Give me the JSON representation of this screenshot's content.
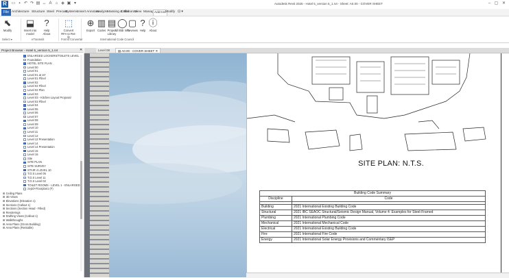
{
  "window": {
    "app_logo": "R",
    "title": "Autodesk Revit 2025 - Hotel 5_version 5_1.rvt - Sheet: A0.00 - COVER SHEET"
  },
  "menu": {
    "file": "File",
    "items": [
      "Architecture",
      "Structure",
      "Steel",
      "Precast",
      "Systems",
      "Insert",
      "Annotate",
      "Analyze",
      "Massing & Site",
      "Collaborate",
      "View",
      "Manage",
      "Add-Ins",
      "Modify"
    ],
    "active": "Add-Ins"
  },
  "ribbon": {
    "buttons": [
      {
        "label": "Modify",
        "icon": "cursor-icon",
        "glyph": "⬉"
      },
      {
        "label": "Insert into model",
        "icon": "insert-icon",
        "glyph": "⬓"
      },
      {
        "label": "Help\nAbout",
        "icon": "help-icon",
        "glyph": "?"
      },
      {
        "label": "Convert RFA to Rvt-fit",
        "icon": "convert-icon",
        "glyph": "⬚"
      },
      {
        "label": "Export",
        "icon": "export-icon",
        "glyph": "⊕"
      },
      {
        "label": "Codes",
        "icon": "codes-icon",
        "glyph": "▥"
      },
      {
        "label": "Project Library",
        "icon": "library-icon",
        "glyph": "▤"
      },
      {
        "label": "All Bldr Info",
        "icon": "info-icon",
        "glyph": "◯"
      },
      {
        "label": "Reviews",
        "icon": "reviews-icon",
        "glyph": "▢"
      },
      {
        "label": "Help",
        "icon": "help2-icon",
        "glyph": "?"
      },
      {
        "label": "About",
        "icon": "about-icon",
        "glyph": "ⓘ"
      }
    ],
    "panels": [
      "Select ▾",
      "eTransmit",
      "Formit Converter",
      "International Code Council"
    ]
  },
  "browser": {
    "title": "Project Browser - Hotel 5_version 5_1.rvt",
    "items": [
      {
        "label": "ENLARGED LOCKERS/TOILETS LEVEL",
        "sel": true
      },
      {
        "label": "Foundation",
        "sel": false
      },
      {
        "label": "HOTEL SITE PLAN",
        "sel": true
      },
      {
        "label": "Level 00",
        "sel": false
      },
      {
        "label": "Level 01",
        "sel": false
      },
      {
        "label": "Level 01 at 10'",
        "sel": false
      },
      {
        "label": "Level 01 Ffinel",
        "sel": false
      },
      {
        "label": "Level 02",
        "sel": true
      },
      {
        "label": "Level 02 Ffinel",
        "sel": false
      },
      {
        "label": "Level 02 Plan",
        "sel": false
      },
      {
        "label": "Level 03",
        "sel": true
      },
      {
        "label": "Level 03 - Kitchen Layout Proposal",
        "sel": false
      },
      {
        "label": "Level 03 Ffinel",
        "sel": false
      },
      {
        "label": "Level 04",
        "sel": true
      },
      {
        "label": "Level 05",
        "sel": true
      },
      {
        "label": "Level 06",
        "sel": false
      },
      {
        "label": "Level 07",
        "sel": false
      },
      {
        "label": "Level 08",
        "sel": true
      },
      {
        "label": "Level 09",
        "sel": false
      },
      {
        "label": "Level 10",
        "sel": true
      },
      {
        "label": "Level 11",
        "sel": false
      },
      {
        "label": "Level 12",
        "sel": false
      },
      {
        "label": "Level 12 Presentation",
        "sel": false
      },
      {
        "label": "Level 14",
        "sel": true
      },
      {
        "label": "Level 14 Presentation",
        "sel": false
      },
      {
        "label": "Level 15",
        "sel": true
      },
      {
        "label": "Level 16",
        "sel": false
      },
      {
        "label": "Site",
        "sel": false
      },
      {
        "label": "SITE PLAN",
        "sel": true
      },
      {
        "label": "SITE SURVEY",
        "sel": false
      },
      {
        "label": "STAIR 4 LEVEL 10",
        "sel": true
      },
      {
        "label": "T.O.S Level 05",
        "sel": false
      },
      {
        "label": "T.O.S Level 11",
        "sel": false
      },
      {
        "label": "T.O.S Level 02",
        "sel": false
      },
      {
        "label": "TOILET ROOMS - LEVEL 1 - ENLARGED",
        "sel": true
      },
      {
        "label": "zoyld+Floorplan1 (F)",
        "sel": false
      }
    ],
    "groups": [
      "Ceiling Plans",
      "3D Views",
      "Elevations (Elevation 1)",
      "Sections (Callout 1)",
      "Sections (Section Head - Filled)",
      "Renderings",
      "Drafting Views (Callout 1)",
      "Walkthroughs",
      "Area Plans (Gross Building)",
      "Area Plans (Rentable)"
    ]
  },
  "tabs": [
    {
      "label": "Level 08"
    },
    {
      "label": "A0.00 - COVER SHEET"
    }
  ],
  "sheet": {
    "site_title": "SITE PLAN: N.T.S.",
    "summary_title": "Building Code Summary",
    "col_discipline": "Discipline",
    "col_code": "Code",
    "rows": [
      {
        "discipline": "Building",
        "code": "2021 International Existing Building Code"
      },
      {
        "discipline": "Structural",
        "code": "2021 IBC SEAOC Structural/Seismic Design Manual, Volume 4: Examples for Steel-Framed"
      },
      {
        "discipline": "Plumbing",
        "code": "2021 International Plumbing Code"
      },
      {
        "discipline": "Mechanical",
        "code": "2021 International Mechanical Code"
      },
      {
        "discipline": "Electrical",
        "code": "2021 International Existing Building Code"
      },
      {
        "discipline": "Fire",
        "code": "2021 International Fire Code"
      },
      {
        "discipline": "Energy",
        "code": "2021 International Solar Energy Provisions and Commentary ISEP"
      }
    ]
  },
  "colors": {
    "accent": "#2b65b5",
    "selected_view": "#4f7cc3"
  }
}
